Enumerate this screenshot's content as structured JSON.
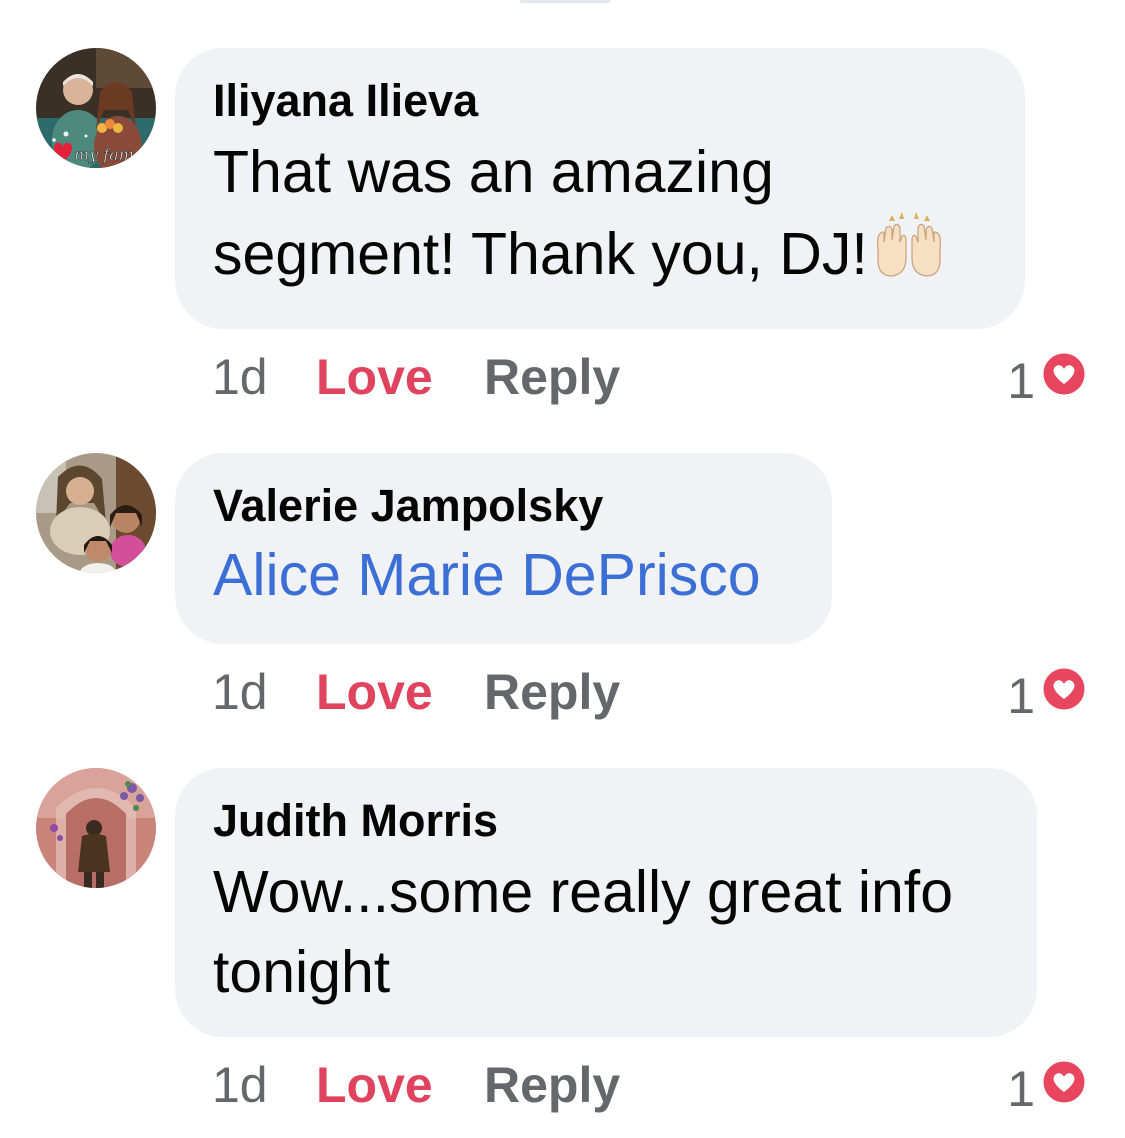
{
  "comments": [
    {
      "author": "Iliyana Ilieva",
      "text_lines": [
        "That was an amazing",
        "segment! Thank you, DJ!"
      ],
      "emoji": "raising-hands",
      "time": "1d",
      "love_label": "Love",
      "reply_label": "Reply",
      "reaction_count": "1"
    },
    {
      "author": "Valerie Jampolsky",
      "mention": "Alice Marie DePrisco",
      "time": "1d",
      "love_label": "Love",
      "reply_label": "Reply",
      "reaction_count": "1"
    },
    {
      "author": "Judith Morris",
      "text_lines": [
        "Wow...some really great info",
        "tonight"
      ],
      "time": "1d",
      "love_label": "Love",
      "reply_label": "Reply",
      "reaction_count": "1"
    }
  ],
  "avatar_overlay": "my fam",
  "colors": {
    "bubble": "#f0f2f5",
    "love": "#e0435e",
    "mention": "#3b6fd6",
    "meta": "#65676b",
    "text": "#050505"
  }
}
